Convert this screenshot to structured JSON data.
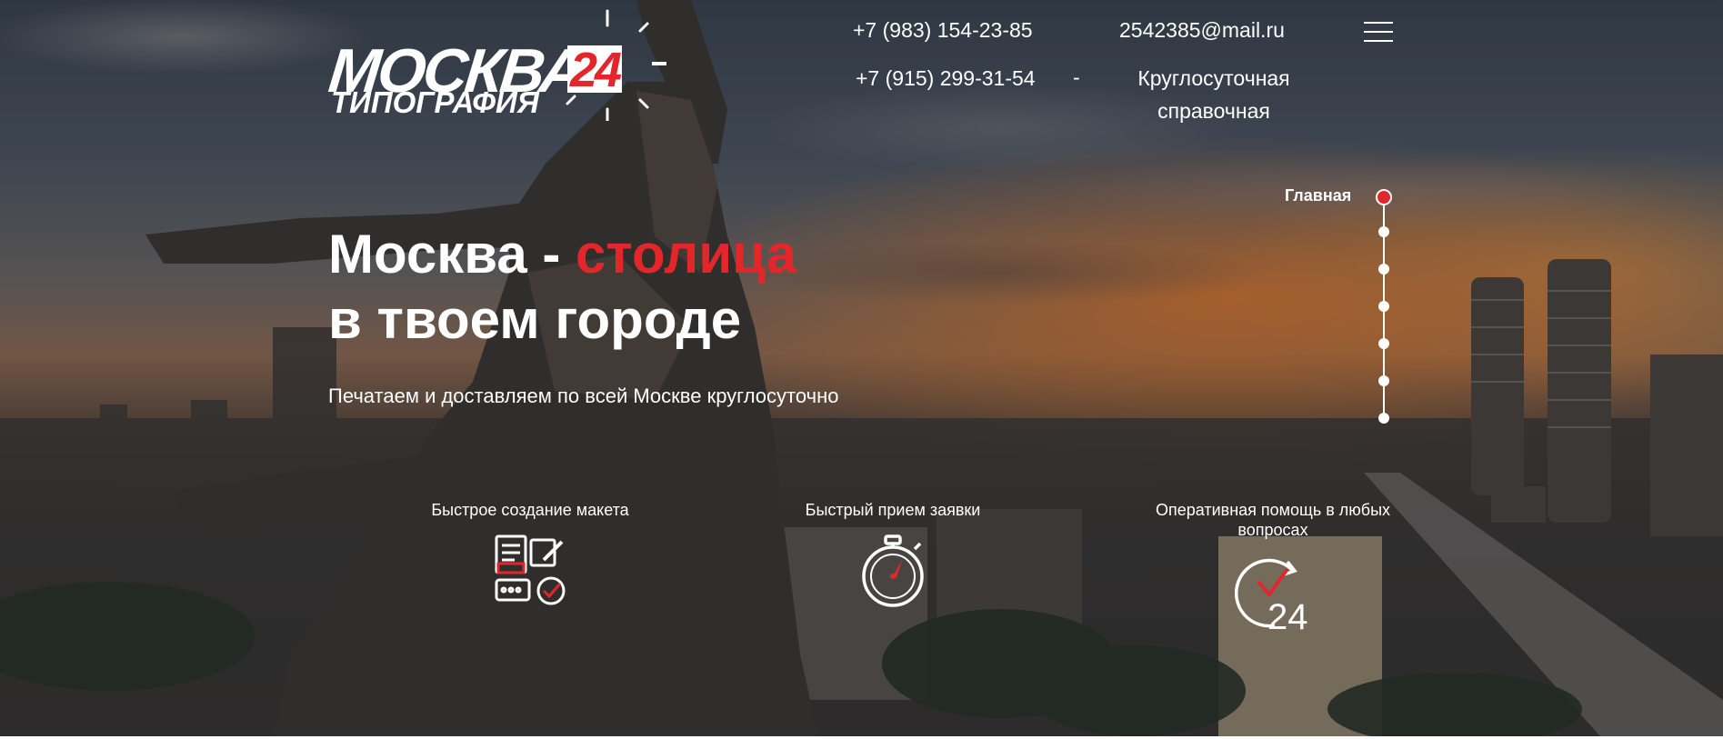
{
  "brand": {
    "logo_word": "МОСКВА",
    "logo_number": "24",
    "logo_sub": "ТИПОГРАФИЯ"
  },
  "contacts": {
    "phone_1": "+7 (983) 154-23-85",
    "phone_2": "+7 (915) 299-31-54",
    "email": "2542385@mail.ru",
    "separator": "-",
    "support_line_1": "Круглосуточная",
    "support_line_2": "справочная"
  },
  "hero": {
    "title_part_1": "Москва - ",
    "title_highlight": "столица",
    "title_line_2": "в твоем городе",
    "subtitle": "Печатаем и доставляем по всей Москве круглосуточно"
  },
  "side_nav": {
    "active_label": "Главная",
    "items_count_visible": 7
  },
  "features": [
    {
      "title": "Быстрое создание макета",
      "icon": "layout-design-icon"
    },
    {
      "title": "Быстрый прием заявки",
      "icon": "stopwatch-icon"
    },
    {
      "title": "Оперативная помощь в любых вопросах",
      "icon": "clock-24-icon"
    }
  ],
  "colors": {
    "accent": "#e3262a",
    "text": "#ffffff"
  }
}
